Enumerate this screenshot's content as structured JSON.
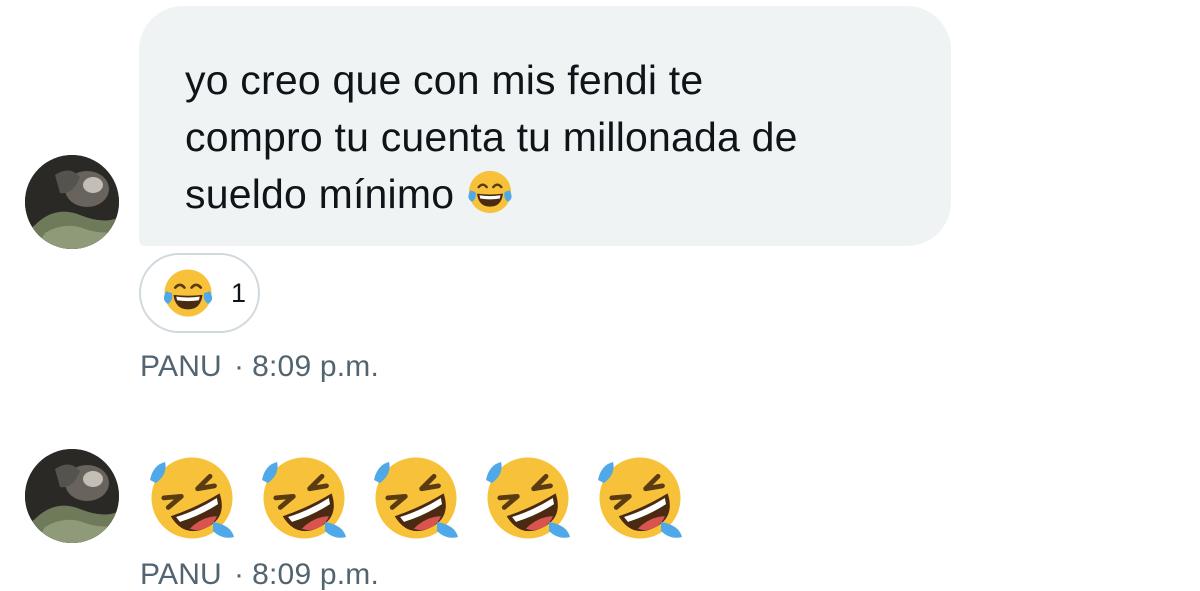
{
  "messages": [
    {
      "sender": "PANU",
      "time": "8:09 p.m.",
      "text": "yo creo que con mis fendi te\ncompro tu cuenta tu millonada de\nsueldo mínimo",
      "inline_emoji": "face-with-tears-of-joy-icon",
      "reaction": {
        "emoji": "face-with-tears-of-joy-icon",
        "count": "1"
      }
    },
    {
      "sender": "PANU",
      "time": "8:09 p.m.",
      "emojis": [
        "rolling-on-floor-laughing-icon",
        "rolling-on-floor-laughing-icon",
        "rolling-on-floor-laughing-icon",
        "rolling-on-floor-laughing-icon",
        "rolling-on-floor-laughing-icon"
      ]
    }
  ],
  "separator": "·",
  "colors": {
    "bubble_bg": "#eff3f4",
    "text": "#0f1419",
    "meta_text": "#536471",
    "reaction_border": "#cfd9de",
    "emoji_yellow": "#f7c23a"
  }
}
